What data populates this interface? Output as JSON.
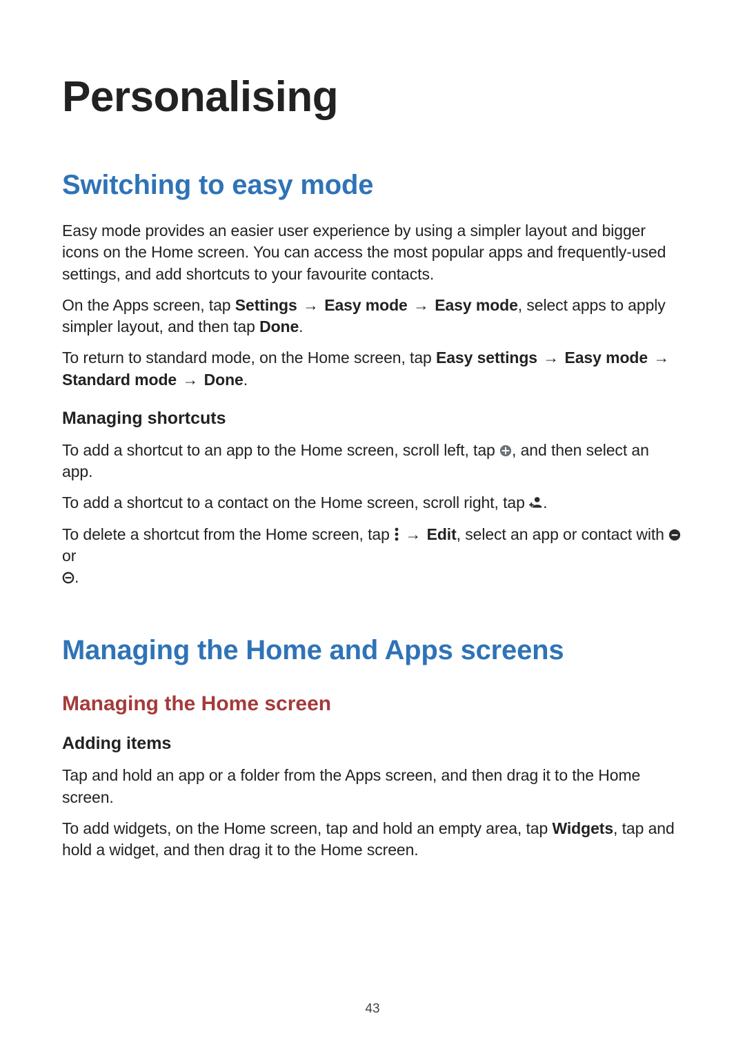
{
  "page_number": "43",
  "title": "Personalising",
  "s1": {
    "heading": "Switching to easy mode",
    "p1": "Easy mode provides an easier user experience by using a simpler layout and bigger icons on the Home screen. You can access the most popular apps and frequently-used settings, and add shortcuts to your favourite contacts.",
    "p2_a": "On the Apps screen, tap ",
    "p2_b1": "Settings",
    "p2_b2": "Easy mode",
    "p2_b3": "Easy mode",
    "p2_c": ", select apps to apply simpler layout, and then tap ",
    "p2_b4": "Done",
    "p2_d": ".",
    "p3_a": "To return to standard mode, on the Home screen, tap ",
    "p3_b1": "Easy settings",
    "p3_b2": "Easy mode",
    "p3_b3": "Standard mode",
    "p3_b4": "Done",
    "p3_d": ".",
    "h4": "Managing shortcuts",
    "p4_a": "To add a shortcut to an app to the Home screen, scroll left, tap ",
    "p4_b": ", and then select an app.",
    "p5_a": "To add a shortcut to a contact on the Home screen, scroll right, tap ",
    "p5_b": ".",
    "p6_a": "To delete a shortcut from the Home screen, tap ",
    "p6_edit": "Edit",
    "p6_b": ", select an app or contact with ",
    "p6_c": " or ",
    "p6_d": "."
  },
  "s2": {
    "heading": "Managing the Home and Apps screens",
    "sub1": "Managing the Home screen",
    "h4": "Adding items",
    "p1": "Tap and hold an app or a folder from the Apps screen, and then drag it to the Home screen.",
    "p2_a": "To add widgets, on the Home screen, tap and hold an empty area, tap ",
    "p2_b1": "Widgets",
    "p2_b": ", tap and hold a widget, and then drag it to the Home screen."
  },
  "arrow": "→"
}
